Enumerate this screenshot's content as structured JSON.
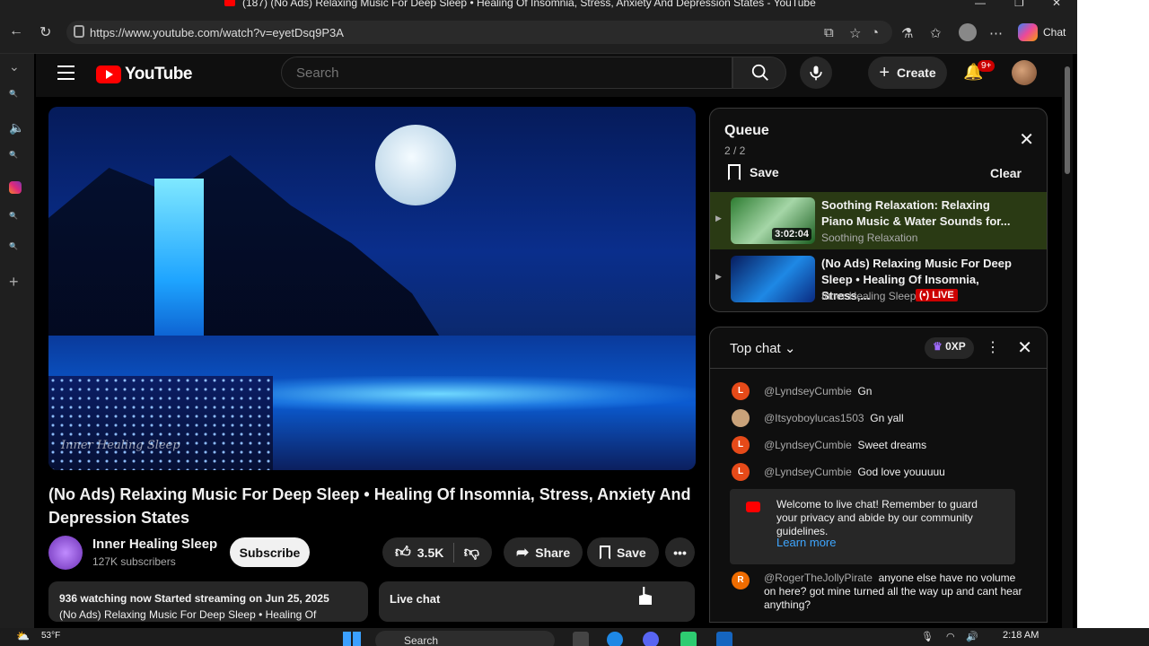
{
  "window": {
    "title": "(187) (No Ads) Relaxing Music For Deep Sleep • Healing Of Insomnia, Stress, Anxiety And Depression States - YouTube"
  },
  "browser": {
    "url": "https://www.youtube.com/watch?v=eyetDsq9P3A",
    "chat_label": "Chat"
  },
  "header": {
    "logo_text": "YouTube",
    "search_placeholder": "Search",
    "create_label": "Create",
    "notif_badge": "9+"
  },
  "video": {
    "title": "(No Ads) Relaxing Music For Deep Sleep • Healing Of Insomnia, Stress, Anxiety And Depression States",
    "watermark": "Inner Healing Sleep",
    "channel": "Inner Healing Sleep",
    "subscribers": "127K subscribers",
    "subscribe_label": "Subscribe",
    "likes": "3.5K",
    "share_label": "Share",
    "save_label": "Save",
    "desc_line1": "936 watching now  Started streaming on Jun 25, 2025",
    "desc_line2": "(No Ads) Relaxing Music For Deep Sleep • Healing Of",
    "livechat_mini": "Live chat"
  },
  "queue": {
    "title": "Queue",
    "count": "2 / 2",
    "save_label": "Save",
    "clear_label": "Clear",
    "items": [
      {
        "title": "Soothing Relaxation: Relaxing Piano Music & Water Sounds for...",
        "channel": "Soothing Relaxation",
        "duration": "3:02:04"
      },
      {
        "title": "(No Ads) Relaxing Music For Deep Sleep • Healing Of Insomnia, Stress,...",
        "channel": "Inner Healing Sleep",
        "live": "LIVE"
      }
    ]
  },
  "chat": {
    "mode": "Top chat",
    "xp": "0XP",
    "messages": [
      {
        "user": "@LyndseyCumbie",
        "text": "Gn",
        "initial": "L",
        "color": "#e64a19"
      },
      {
        "user": "@Itsyoboylucas1503",
        "text": "Gn yall",
        "initial": "",
        "color": "#c9a27a"
      },
      {
        "user": "@LyndseyCumbie",
        "text": "Sweet dreams",
        "initial": "L",
        "color": "#e64a19"
      },
      {
        "user": "@LyndseyCumbie",
        "text": "God love youuuuu",
        "initial": "L",
        "color": "#e64a19"
      }
    ],
    "welcome": "Welcome to live chat! Remember to guard your privacy and abide by our community guidelines.",
    "learn_more": "Learn more",
    "last_user": "@RogerTheJollyPirate",
    "last_initial": "R",
    "last_text": "anyone else have no volume on here? got mine turned all the way up and cant hear anything?"
  },
  "taskbar": {
    "weather": "53°F",
    "search": "Search",
    "time": "2:18 AM"
  }
}
